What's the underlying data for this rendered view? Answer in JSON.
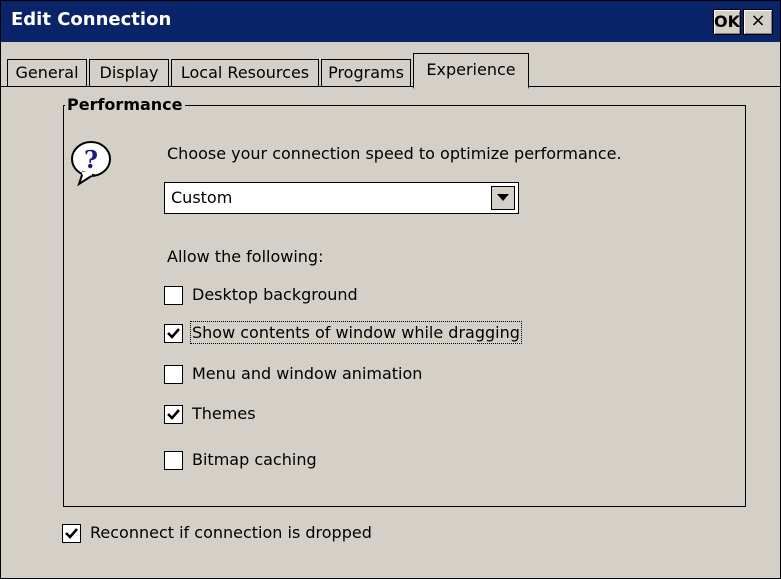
{
  "window": {
    "title": "Edit Connection",
    "ok_label": "OK",
    "close_label": "×"
  },
  "tabs": [
    {
      "label": "General",
      "active": false
    },
    {
      "label": "Display",
      "active": false
    },
    {
      "label": "Local Resources",
      "active": false
    },
    {
      "label": "Programs",
      "active": false
    },
    {
      "label": "Experience",
      "active": true
    }
  ],
  "performance": {
    "group_label": "Performance",
    "help_icon": "question-icon",
    "prompt": "Choose your connection speed to optimize performance.",
    "speed": {
      "selected": "Custom"
    },
    "allow_label": "Allow the following:",
    "options": [
      {
        "label": "Desktop background",
        "checked": false
      },
      {
        "label": "Show contents of window while dragging",
        "checked": true
      },
      {
        "label": "Menu and window animation",
        "checked": false
      },
      {
        "label": "Themes",
        "checked": true
      },
      {
        "label": "Bitmap caching",
        "checked": false
      }
    ]
  },
  "reconnect": {
    "label": "Reconnect if connection is dropped",
    "checked": true
  },
  "colors": {
    "titlebar": "#0a246a",
    "face": "#d4d0c8"
  }
}
